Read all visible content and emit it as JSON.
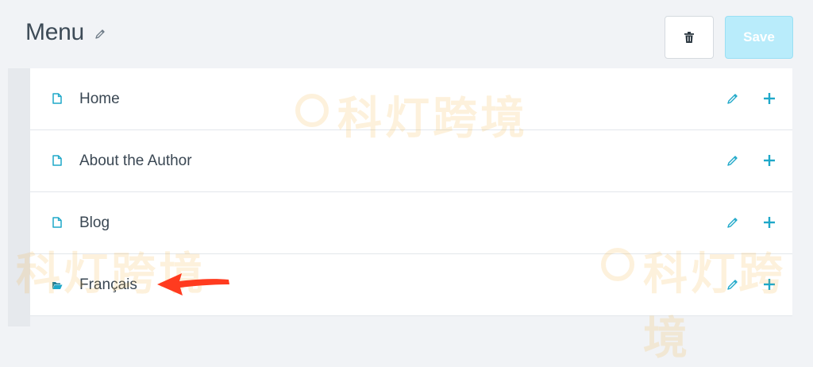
{
  "header": {
    "title": "Menu",
    "save_label": "Save"
  },
  "menu": {
    "items": [
      {
        "label": "Home",
        "icon": "page-icon"
      },
      {
        "label": "About the Author",
        "icon": "page-icon"
      },
      {
        "label": "Blog",
        "icon": "page-icon"
      },
      {
        "label": "Français",
        "icon": "folder-open-icon"
      }
    ]
  },
  "watermark": {
    "text": "科灯跨境"
  },
  "colors": {
    "accent": "#1fa8c9",
    "save_bg": "#b9ecfb",
    "annotation_arrow": "#ff3b1f",
    "watermark": "#f5a623"
  }
}
